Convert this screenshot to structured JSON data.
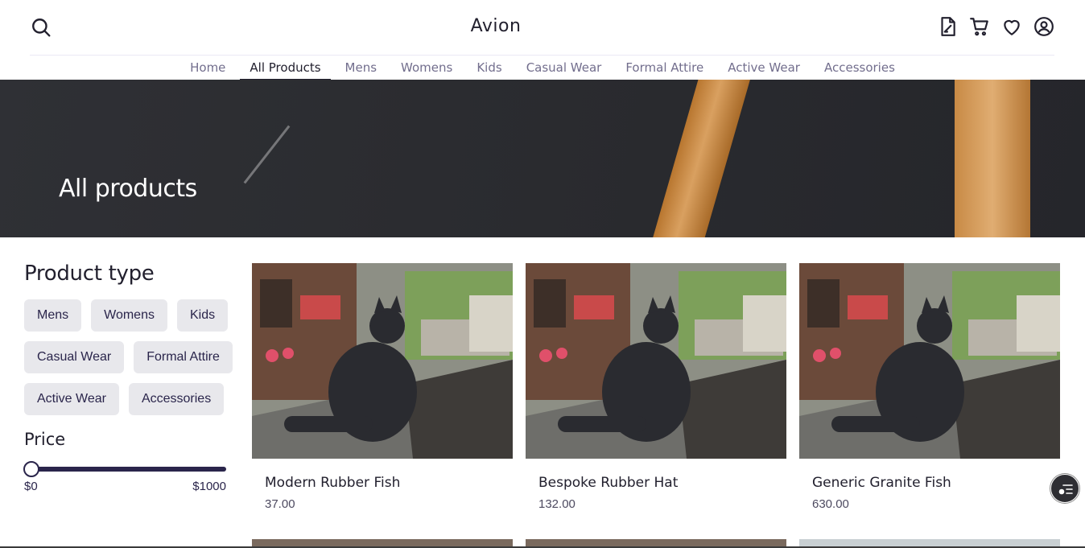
{
  "header": {
    "brand": "Avion",
    "icons": [
      "search-icon",
      "document-icon",
      "cart-icon",
      "heart-icon",
      "user-icon"
    ]
  },
  "nav": {
    "items": [
      {
        "label": "Home",
        "active": false
      },
      {
        "label": "All Products",
        "active": true
      },
      {
        "label": "Mens",
        "active": false
      },
      {
        "label": "Womens",
        "active": false
      },
      {
        "label": "Kids",
        "active": false
      },
      {
        "label": "Casual Wear",
        "active": false
      },
      {
        "label": "Formal Attire",
        "active": false
      },
      {
        "label": "Active Wear",
        "active": false
      },
      {
        "label": "Accessories",
        "active": false
      }
    ]
  },
  "hero": {
    "title": "All products"
  },
  "filters": {
    "product_type_title": "Product type",
    "product_types": [
      "Mens",
      "Womens",
      "Kids",
      "Casual Wear",
      "Formal Attire",
      "Active Wear",
      "Accessories"
    ],
    "price_title": "Price",
    "price_min_label": "$0",
    "price_max_label": "$1000",
    "price_selected_fraction": 0
  },
  "products": [
    {
      "name": "Modern Rubber Fish",
      "price": "37.00"
    },
    {
      "name": "Bespoke Rubber Hat",
      "price": "132.00"
    },
    {
      "name": "Generic Granite Fish",
      "price": "630.00"
    }
  ],
  "colors": {
    "primary": "#2a254b",
    "chip_bg": "#e8e8ec",
    "text_muted": "#726e8d"
  }
}
